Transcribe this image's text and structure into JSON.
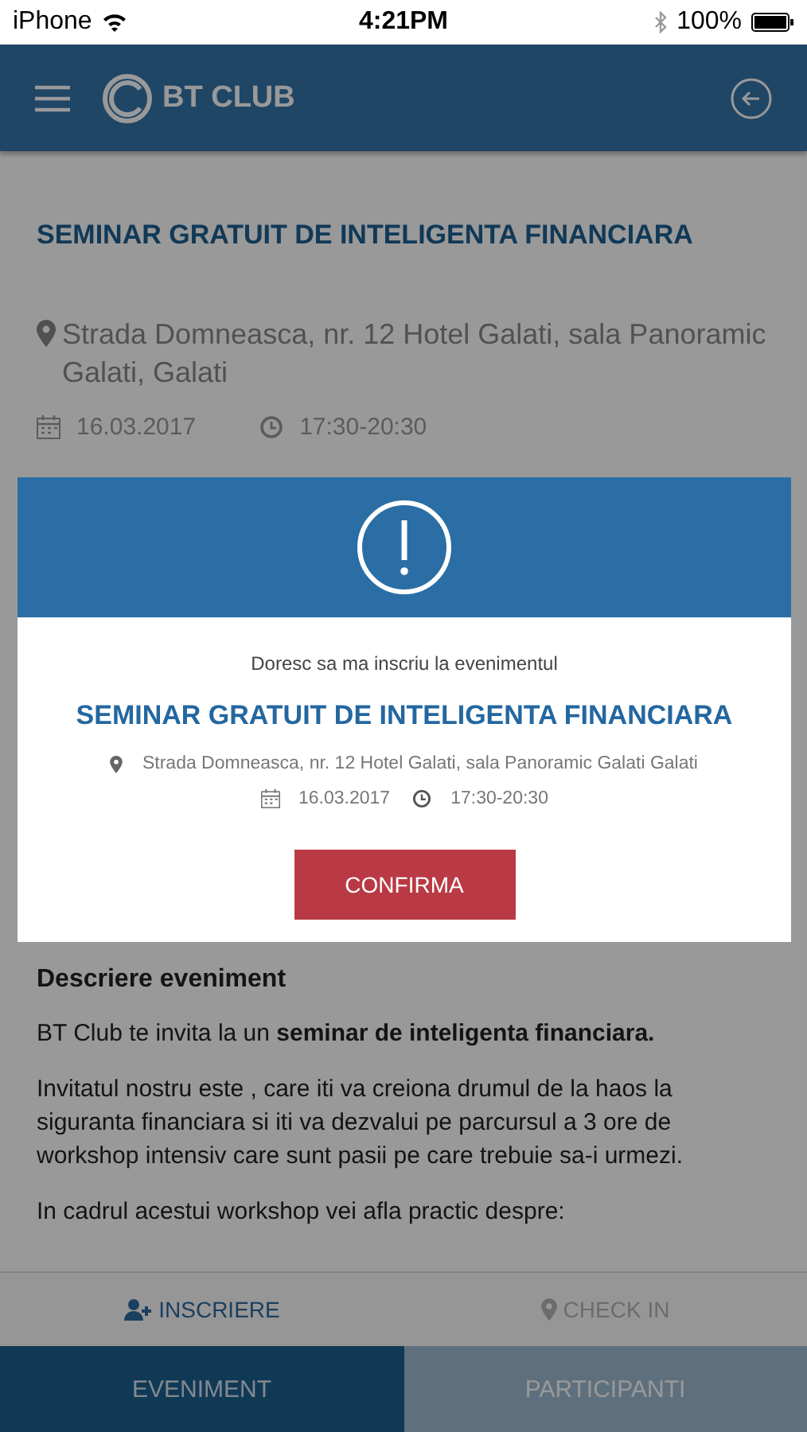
{
  "status_bar": {
    "carrier": "iPhone",
    "time": "4:21PM",
    "battery": "100%"
  },
  "header": {
    "logo": "BT CLUB"
  },
  "event": {
    "title": "SEMINAR GRATUIT DE INTELIGENTA FINANCIARA",
    "address": "Strada Domneasca, nr. 12 Hotel Galati, sala Panoramic Galati, Galati",
    "date": "16.03.2017",
    "time": "17:30-20:30"
  },
  "description": {
    "heading": "Descriere eveniment",
    "paragraphs": [
      "BT Club te invita la un **seminar de inteligenta financiara.**",
      "Invitatul nostru este , care iti va creiona drumul de la haos la siguranta financiara si iti va dezvalui pe parcursul a 3 ore de workshop intensiv care sunt pasii pe care trebuie sa-i urmezi.",
      "In cadrul acestui workshop vei afla practic despre:"
    ]
  },
  "actions": [
    {
      "label": "INSCRIERE",
      "kind": "register",
      "disabled": false
    },
    {
      "label": "CHECK IN",
      "kind": "checkin",
      "disabled": true
    }
  ],
  "tabs": [
    {
      "label": "EVENIMENT",
      "selected": true
    },
    {
      "label": "PARTICIPANTI",
      "selected": false
    }
  ],
  "dialog": {
    "prompt": "Doresc sa ma inscriu la evenimentul",
    "title": "SEMINAR GRATUIT DE INTELIGENTA FINANCIARA",
    "address": "Strada Domneasca, nr. 12 Hotel Galati, sala Panoramic Galati Galati",
    "date": "16.03.2017",
    "time": "17:30-20:30",
    "button": "CONFIRMA"
  }
}
